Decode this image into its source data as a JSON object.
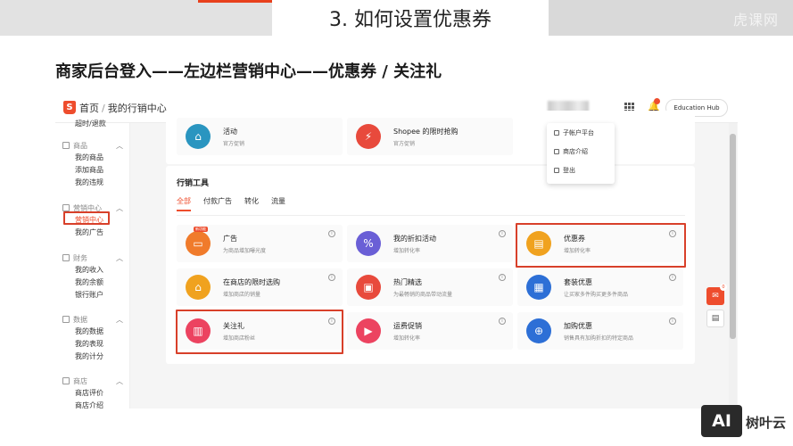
{
  "slide": {
    "title": "3. 如何设置优惠券",
    "watermark": "虎课网",
    "subtitle": "商家后台登入——左边栏营销中心——优惠券 /   关注礼"
  },
  "app": {
    "breadcrumb": {
      "home": "首页",
      "separator": "/",
      "current": "我的行销中心"
    },
    "logo_letter": "S",
    "edu_button": "Education Hub",
    "dropdown": [
      "子帐户平台",
      "商店介绍",
      "登出"
    ],
    "sidebar": {
      "top_clipped": "超时/退款",
      "groups": [
        {
          "label": "商品",
          "items": [
            "我的商品",
            "添加商品",
            "我的违规"
          ]
        },
        {
          "label": "营销中心",
          "items": [
            "营销中心",
            "我的广告"
          ]
        },
        {
          "label": "财务",
          "items": [
            "我的收入",
            "我的余额",
            "银行账户"
          ]
        },
        {
          "label": "数据",
          "items": [
            "我的数据",
            "我的表现",
            "我的计分"
          ]
        },
        {
          "label": "商店",
          "items": [
            "商店评价",
            "商店介绍"
          ]
        }
      ]
    },
    "top_tools": [
      {
        "name": "活动",
        "desc": "官方促销"
      },
      {
        "name": "Shopee 的限时抢购",
        "desc": "官方促销"
      }
    ],
    "marketing": {
      "title": "行销工具",
      "tabs": [
        "全部",
        "付款广告",
        "转化",
        "流量"
      ],
      "tools": [
        {
          "name": "广告",
          "desc": "为商品增加曝光度",
          "badge": "新功能",
          "color": "#f07b2b"
        },
        {
          "name": "我的折扣活动",
          "desc": "增加转化率",
          "color": "#6a5fd6"
        },
        {
          "name": "优惠券",
          "desc": "增加转化率",
          "color": "#f0a21f"
        },
        {
          "name": "在商店的限时选购",
          "desc": "增加商店的销量",
          "color": "#f0a21f"
        },
        {
          "name": "热门精选",
          "desc": "为最畅销的商品带动流量",
          "color": "#e84a3c"
        },
        {
          "name": "套装优惠",
          "desc": "让买家多件购买更多件商品",
          "color": "#2d6fd6"
        },
        {
          "name": "关注礼",
          "desc": "增加商店粉丝",
          "color": "#ec4360"
        },
        {
          "name": "运费促销",
          "desc": "增加转化率",
          "color": "#ec4360"
        },
        {
          "name": "加购优惠",
          "desc": "销售具有加购折扣的特定商品",
          "color": "#2d6fd6"
        }
      ]
    },
    "chat_count": "0"
  },
  "brand": {
    "logo": "AI",
    "name": "树叶云"
  }
}
